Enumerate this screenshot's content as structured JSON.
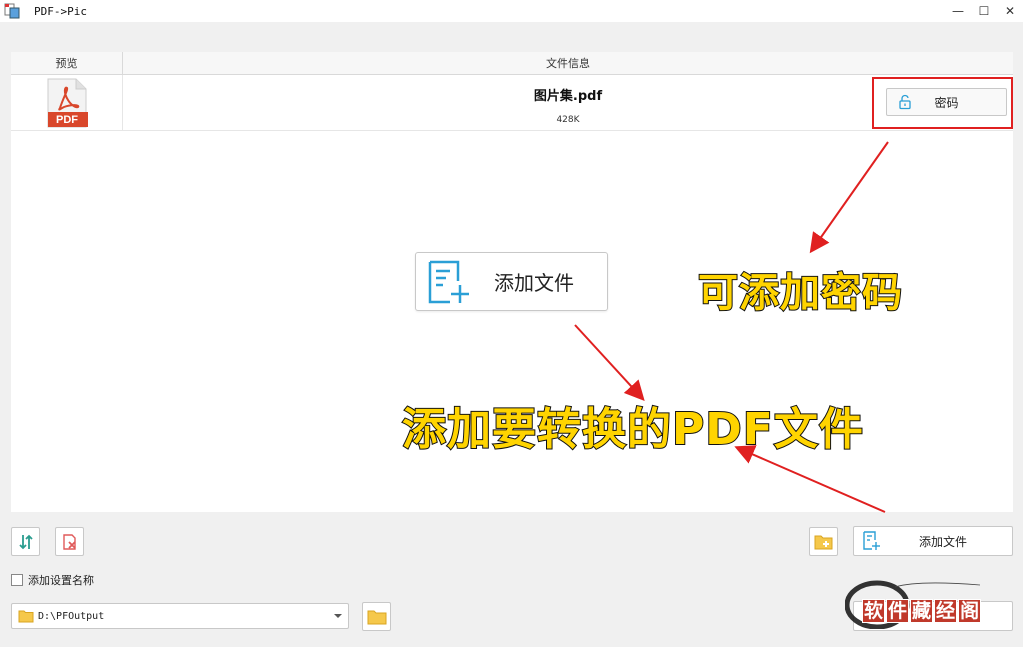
{
  "window": {
    "title": "PDF->Pic",
    "minimize": "—",
    "maximize": "☐",
    "close": "✕"
  },
  "table": {
    "columns": [
      "预览",
      "文件信息"
    ],
    "rows": [
      {
        "thumb_label": "PDF",
        "name": "图片集.pdf",
        "size": "428K",
        "password_label": "密码"
      }
    ]
  },
  "center": {
    "add_file_label": "添加文件"
  },
  "annotations": {
    "password": "可添加密码",
    "pdf": "添加要转换的PDF文件"
  },
  "toolbar": {
    "add_file_label": "添加文件"
  },
  "options": {
    "add_settings_name_label": "添加设置名称",
    "add_settings_name_checked": false
  },
  "output": {
    "path": "D:\\PFOutput"
  },
  "watermark": {
    "chars": [
      "软",
      "件",
      "藏",
      "经",
      "阁"
    ]
  },
  "colors": {
    "accent": "#2a9fd6",
    "annotation_red": "#e02020",
    "annotation_yellow": "#ffd400",
    "pdf_red": "#d9472b"
  }
}
